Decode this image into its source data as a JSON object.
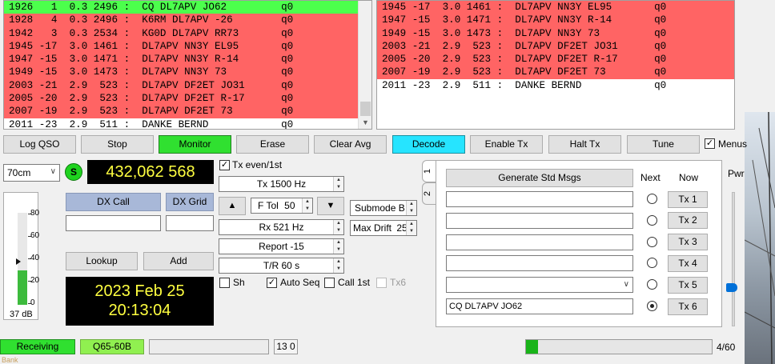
{
  "left_pane": {
    "lines": [
      {
        "text": "1926   1  0.3 2496 :  CQ DL7APV JO62         q0",
        "color": "green"
      },
      {
        "text": "1928   4  0.3 2496 :  K6RM DL7APV -26        q0",
        "color": "red"
      },
      {
        "text": "1942   3  0.3 2534 :  KG0D DL7APV RR73       q0",
        "color": "red"
      },
      {
        "text": "1945 -17  3.0 1461 :  DL7APV NN3Y EL95       q0",
        "color": "red"
      },
      {
        "text": "1947 -15  3.0 1471 :  DL7APV NN3Y R-14       q0",
        "color": "red"
      },
      {
        "text": "1949 -15  3.0 1473 :  DL7APV NN3Y 73         q0",
        "color": "red"
      },
      {
        "text": "2003 -21  2.9  523 :  DL7APV DF2ET JO31      q0",
        "color": "red"
      },
      {
        "text": "2005 -20  2.9  523 :  DL7APV DF2ET R-17      q0",
        "color": "red"
      },
      {
        "text": "2007 -19  2.9  523 :  DL7APV DF2ET 73        q0",
        "color": "red"
      },
      {
        "text": "2011 -23  2.9  511 :  DANKE BERND            q0",
        "color": "none"
      }
    ]
  },
  "right_pane": {
    "lines": [
      {
        "text": "1945 -17  3.0 1461 :  DL7APV NN3Y EL95       q0",
        "color": "red"
      },
      {
        "text": "1947 -15  3.0 1471 :  DL7APV NN3Y R-14       q0",
        "color": "red"
      },
      {
        "text": "1949 -15  3.0 1473 :  DL7APV NN3Y 73         q0",
        "color": "red"
      },
      {
        "text": "2003 -21  2.9  523 :  DL7APV DF2ET JO31      q0",
        "color": "red"
      },
      {
        "text": "2005 -20  2.9  523 :  DL7APV DF2ET R-17      q0",
        "color": "red"
      },
      {
        "text": "2007 -19  2.9  523 :  DL7APV DF2ET 73        q0",
        "color": "red"
      },
      {
        "text": "2011 -23  2.9  511 :  DANKE BERND            q0",
        "color": "none"
      }
    ]
  },
  "buttons": {
    "log_qso": "Log QSO",
    "stop": "Stop",
    "monitor": "Monitor",
    "erase": "Erase",
    "clear_avg": "Clear Avg",
    "decode": "Decode",
    "enable_tx": "Enable Tx",
    "halt_tx": "Halt Tx",
    "tune": "Tune",
    "menus": "Menus"
  },
  "band": {
    "selected": "70cm"
  },
  "s_badge": "S",
  "frequency": "432,062 568",
  "dx": {
    "call_label": "DX Call",
    "grid_label": "DX Grid",
    "call_value": "",
    "grid_value": "",
    "lookup": "Lookup",
    "add": "Add"
  },
  "meter": {
    "ticks": [
      "80",
      "60",
      "40",
      "20",
      "0"
    ],
    "level_db": "37 dB",
    "fill_fraction": 0.37
  },
  "clock": {
    "date": "2023 Feb 25",
    "time": "20:13:04"
  },
  "controls": {
    "tx_even": "Tx even/1st",
    "tx_even_checked": true,
    "tx_freq": "Tx  1500  Hz",
    "ftol_label": "F Tol",
    "ftol_value": "50",
    "rx_freq": "Rx  521  Hz",
    "report": "Report  -15",
    "tr": "T/R  60  s",
    "submode": "Submode B",
    "max_drift_label": "Max Drift",
    "max_drift_value": "25",
    "sh": "Sh",
    "auto_seq": "Auto Seq",
    "call_1st": "Call 1st",
    "tx6": "Tx6"
  },
  "tabs": [
    "1",
    "2"
  ],
  "msgs": {
    "generate": "Generate Std Msgs",
    "next": "Next",
    "now": "Now",
    "rows": [
      {
        "text": "",
        "btn": "Tx 1",
        "selected": false
      },
      {
        "text": "",
        "btn": "Tx 2",
        "selected": false
      },
      {
        "text": "",
        "btn": "Tx 3",
        "selected": false
      },
      {
        "text": "",
        "btn": "Tx 4",
        "selected": false
      },
      {
        "text": "",
        "btn": "Tx 5",
        "selected": false
      },
      {
        "text": "CQ DL7APV JO62",
        "btn": "Tx 6",
        "selected": true
      }
    ]
  },
  "pwr_label": "Pwr",
  "status_bar": {
    "receiving": "Receiving",
    "mode": "Q65-60B",
    "counter": "13  0",
    "progress_text": "4/60",
    "progress_fraction": 0.0667
  },
  "background_text": "Bank"
}
